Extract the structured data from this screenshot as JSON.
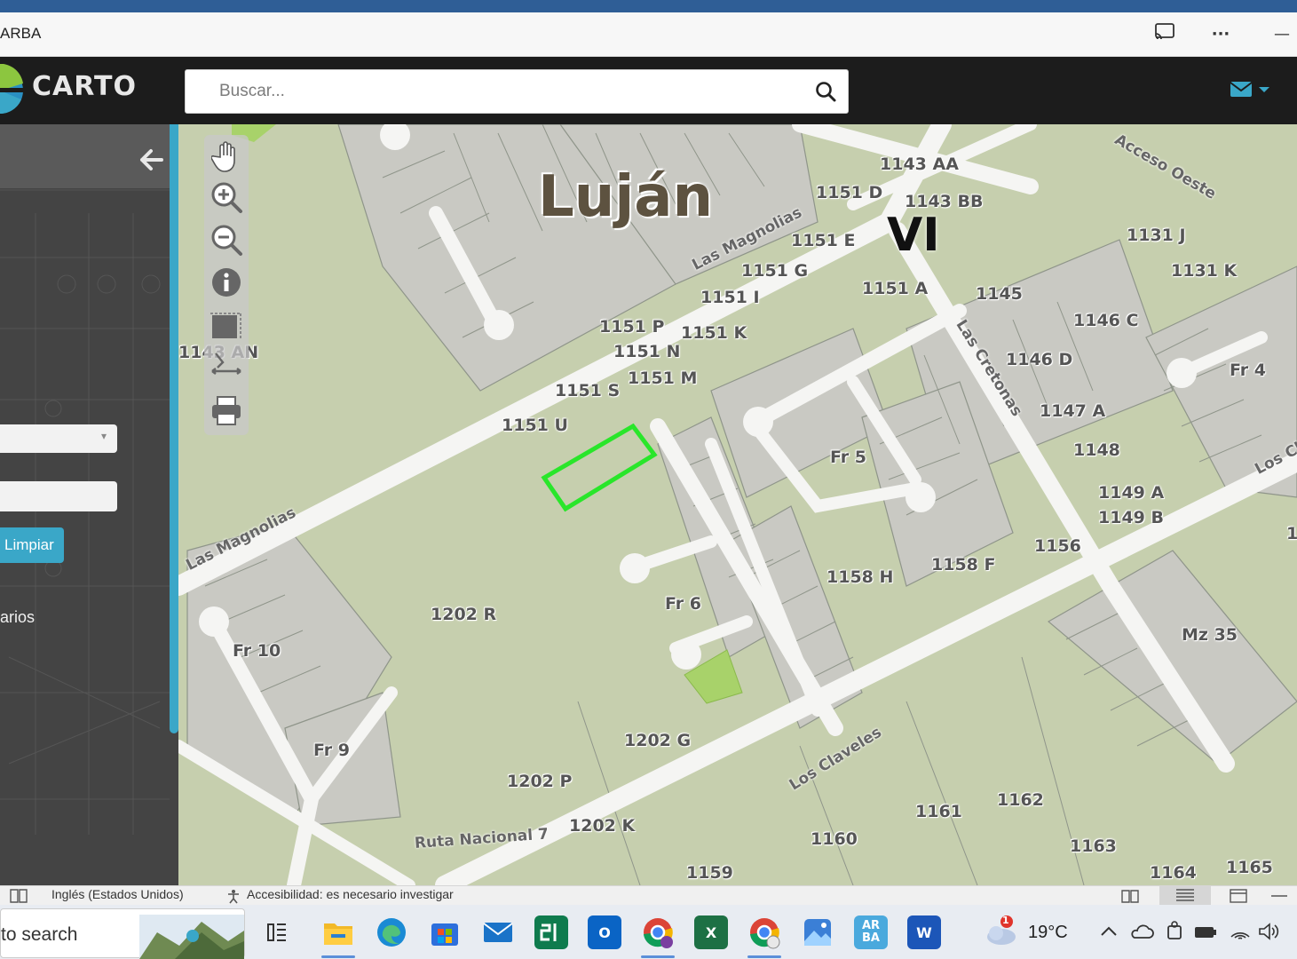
{
  "window": {
    "title": "ARBA",
    "cast_label": "⧉",
    "more_label": "···",
    "minimize_label": "—"
  },
  "header": {
    "brand": "CARTO",
    "search_placeholder": "Buscar..."
  },
  "sidebar": {
    "clear_button": "Limpiar",
    "results_label": "arios",
    "select_arrow": "▾"
  },
  "map": {
    "city": "Luján",
    "sector": "VI",
    "parcel_labels": [
      {
        "text": "1143 AA"
      },
      {
        "text": "1151 D"
      },
      {
        "text": "1143 BB"
      },
      {
        "text": "1151 E"
      },
      {
        "text": "1131 J"
      },
      {
        "text": "1151 G"
      },
      {
        "text": "1131 K"
      },
      {
        "text": "1151 I"
      },
      {
        "text": "1151 A"
      },
      {
        "text": "1145"
      },
      {
        "text": "1146 C"
      },
      {
        "text": "1151 P"
      },
      {
        "text": "1151 K"
      },
      {
        "text": "1151 N"
      },
      {
        "text": "1146 D"
      },
      {
        "text": "Fr 4"
      },
      {
        "text": "1151 S"
      },
      {
        "text": "1151 M"
      },
      {
        "text": "1147 A"
      },
      {
        "text": "1151 U"
      },
      {
        "text": "1148"
      },
      {
        "text": "Fr 5"
      },
      {
        "text": "1149 A"
      },
      {
        "text": "1149 B"
      },
      {
        "text": "1156"
      },
      {
        "text": "1158 F"
      },
      {
        "text": "1158 H"
      },
      {
        "text": "Fr 6"
      },
      {
        "text": "1202 R"
      },
      {
        "text": "Fr 10"
      },
      {
        "text": "Mz 35"
      },
      {
        "text": "1202 G"
      },
      {
        "text": "Fr 9"
      },
      {
        "text": "1202 P"
      },
      {
        "text": "1162"
      },
      {
        "text": "1161"
      },
      {
        "text": "1202 K"
      },
      {
        "text": "1160"
      },
      {
        "text": "1163"
      },
      {
        "text": "1159"
      },
      {
        "text": "1164"
      },
      {
        "text": "1165"
      },
      {
        "text": "1143 AN"
      },
      {
        "text": "1"
      }
    ],
    "streets": [
      {
        "text": "Las Magnolias"
      },
      {
        "text": "Las Magnolias"
      },
      {
        "text": "Las Cretonas"
      },
      {
        "text": "Los Claveles"
      },
      {
        "text": "Ruta Nacional 7"
      },
      {
        "text": "Acceso Oeste"
      },
      {
        "text": "Los Cl"
      }
    ],
    "tools": [
      "pan-icon",
      "zoom-in-icon",
      "zoom-out-icon",
      "info-icon",
      "select-area-icon",
      "measure-icon",
      "print-icon"
    ]
  },
  "statusbar": {
    "language": "Inglés (Estados Unidos)",
    "accessibility": "Accesibilidad: es necesario investigar"
  },
  "taskbar": {
    "search_text": "to search",
    "temperature": "19°C",
    "weather_badge": "1",
    "arba_icon_label": "AR BA",
    "excel_label": "X",
    "word_label": "W",
    "outlook_label": "O"
  }
}
